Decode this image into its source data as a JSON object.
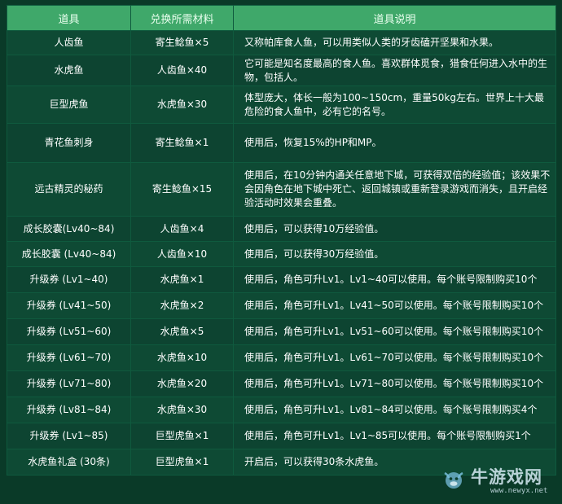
{
  "table": {
    "headers": [
      "道具",
      "兑换所需材料",
      "道具说明"
    ],
    "rows": [
      {
        "item": "人齿鱼",
        "material": "寄生鲶鱼×5",
        "desc": "又称帕库食人鱼，可以用类似人类的牙齿磕开坚果和水果。"
      },
      {
        "item": "水虎鱼",
        "material": "人齿鱼×40",
        "desc": "它可能是知名度最高的食人鱼。喜欢群体觅食，猎食任何进入水中的生物，包括人。"
      },
      {
        "item": "巨型虎鱼",
        "material": "水虎鱼×30",
        "desc": "体型庞大，体长一般为100~150cm，重量50kg左右。世界上十大最危险的食人鱼中，必有它的名号。"
      },
      {
        "item": "青花鱼刺身",
        "material": "寄生鲶鱼×1",
        "desc": "使用后，恢复15%的HP和MP。"
      },
      {
        "item": "远古精灵的秘药",
        "material": "寄生鲶鱼×15",
        "desc": "使用后，在10分钟内通关任意地下城，可获得双倍的经验值；该效果不会因角色在地下城中死亡、返回城镇或重新登录游戏而消失，且开启经验活动时效果会重叠。"
      },
      {
        "item": "成长胶囊(Lv40~84)",
        "material": "人齿鱼×4",
        "desc": "使用后，可以获得10万经验值。"
      },
      {
        "item": "成长胶囊 (Lv40~84)",
        "material": "人齿鱼×10",
        "desc": "使用后，可以获得30万经验值。"
      },
      {
        "item": "升级券 (Lv1~40)",
        "material": "水虎鱼×1",
        "desc": "使用后，角色可升Lv1。Lv1~40可以使用。每个账号限制购买10个"
      },
      {
        "item": "升级券 (Lv41~50)",
        "material": "水虎鱼×2",
        "desc": "使用后，角色可升Lv1。Lv41~50可以使用。每个账号限制购买10个"
      },
      {
        "item": "升级券 (Lv51~60)",
        "material": "水虎鱼×5",
        "desc": "使用后，角色可升Lv1。Lv51~60可以使用。每个账号限制购买10个"
      },
      {
        "item": "升级券 (Lv61~70)",
        "material": "水虎鱼×10",
        "desc": "使用后，角色可升Lv1。Lv61~70可以使用。每个账号限制购买10个"
      },
      {
        "item": "升级券 (Lv71~80)",
        "material": "水虎鱼×20",
        "desc": "使用后，角色可升Lv1。Lv71~80可以使用。每个账号限制购买10个"
      },
      {
        "item": "升级券 (Lv81~84)",
        "material": "水虎鱼×30",
        "desc": "使用后，角色可升Lv1。Lv81~84可以使用。每个账号限制购买4个"
      },
      {
        "item": "升级券 (Lv1~85)",
        "material": "巨型虎鱼×1",
        "desc": "使用后，角色可升Lv1。Lv1~85可以使用。每个账号限制购买1个"
      },
      {
        "item": "水虎鱼礼盒 (30条)",
        "material": "巨型虎鱼×1",
        "desc": "开启后，可以获得30条水虎鱼。"
      }
    ]
  },
  "watermark": {
    "name": "牛游戏网",
    "url": "www.newyx.net"
  },
  "colors": {
    "header_bg": "#3fa86a",
    "row_bg": "#0e4a34",
    "border": "#0f5a3e"
  }
}
